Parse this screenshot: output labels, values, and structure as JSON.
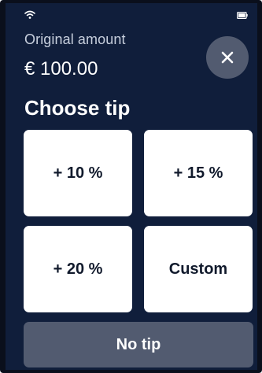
{
  "status_bar": {
    "wifi_icon": "wifi-icon",
    "battery_icon": "battery-icon"
  },
  "payment": {
    "label": "Original amount",
    "amount": "€ 100.00"
  },
  "close_button": {
    "icon": "close-icon"
  },
  "tip": {
    "heading": "Choose tip",
    "options": [
      "+ 10 %",
      "+ 15 %",
      "+ 20 %",
      "Custom"
    ],
    "no_tip_label": "No tip"
  },
  "colors": {
    "background": "#101e3b",
    "option_background": "#ffffff",
    "option_text": "#111a2c",
    "secondary_button": "#525b70",
    "muted_text": "#c7cfdd"
  }
}
